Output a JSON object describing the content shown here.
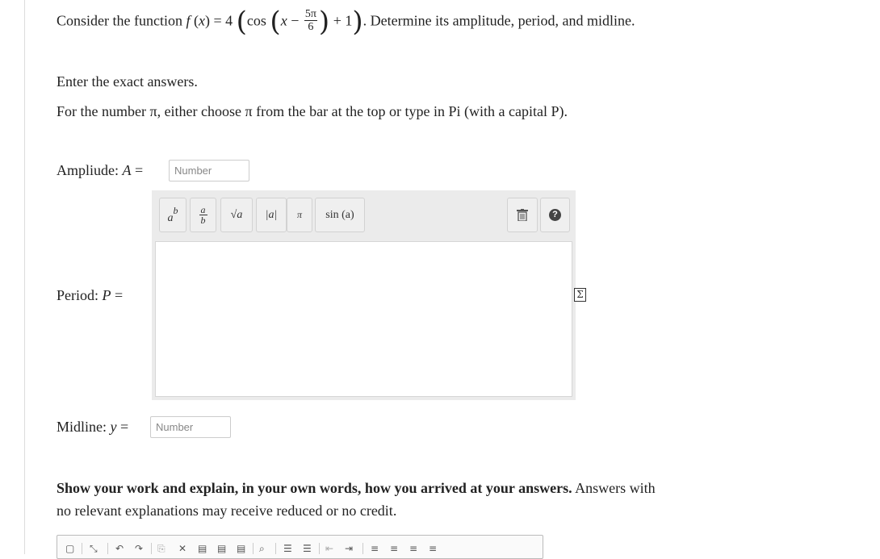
{
  "question": {
    "prefix": "Consider the function",
    "func_name": "f",
    "func_var": "x",
    "amp_coeff": "4",
    "cos": "cos",
    "x": "x",
    "frac_num": "5π",
    "frac_den": "6",
    "plus_one": "+ 1",
    "suffix": ". Determine its amplitude, period, and midline."
  },
  "instructions": {
    "exact": "Enter the exact answers.",
    "pi_text": "For the number π, either choose π from the bar at the top or type in Pi (with a capital P)."
  },
  "amplitude": {
    "label": "Ampliude:",
    "var": "A",
    "eq": "=",
    "placeholder": "Number"
  },
  "period": {
    "label": "Period:",
    "var": "P",
    "eq": "="
  },
  "midline": {
    "label": "Midline:",
    "var": "y",
    "eq": "=",
    "placeholder": "Number"
  },
  "math_toolbar": {
    "power_base": "a",
    "power_exp": "b",
    "frac_top": "a",
    "frac_bottom": "b",
    "sqrt": "√a",
    "abs": "|a|",
    "pi": "π",
    "sin": "sin (a)",
    "trash_icon": "trash-icon",
    "help_label": "?"
  },
  "equation_editor_icon": "Σ",
  "show_work": {
    "bold": "Show your work and explain, in your own words, how you arrived at your answers.",
    "rest_line1": " Answers with",
    "line2": "no relevant explanations may receive reduced or no credit."
  }
}
